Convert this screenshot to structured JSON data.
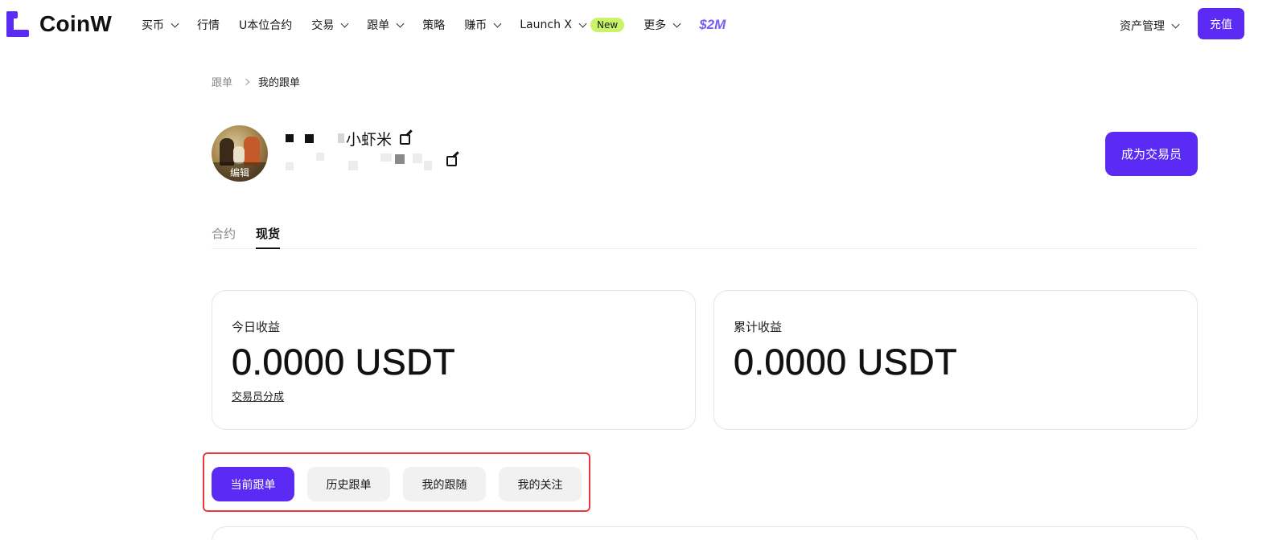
{
  "brand": {
    "name": "CoinW",
    "color": "#5b2bf5"
  },
  "nav": {
    "items": [
      {
        "label": "买币",
        "dropdown": true
      },
      {
        "label": "行情",
        "dropdown": false
      },
      {
        "label": "U本位合约",
        "dropdown": false
      },
      {
        "label": "交易",
        "dropdown": true
      },
      {
        "label": "跟单",
        "dropdown": true
      },
      {
        "label": "策略",
        "dropdown": false
      },
      {
        "label": "赚币",
        "dropdown": true
      },
      {
        "label": "Launch X",
        "dropdown": true,
        "badge": "New"
      },
      {
        "label": "更多",
        "dropdown": true
      }
    ],
    "promo": "$2M",
    "asset_menu": "资产管理",
    "deposit": "充值"
  },
  "breadcrumb": {
    "parent": "跟单",
    "current": "我的跟单"
  },
  "profile": {
    "avatar_edit": "编辑",
    "nickname": "小虾米",
    "become_trader": "成为交易员"
  },
  "tabs": [
    {
      "label": "合约",
      "active": false
    },
    {
      "label": "现货",
      "active": true
    }
  ],
  "cards": {
    "today": {
      "label": "今日收益",
      "value": "0.0000 USDT",
      "link": "交易员分成"
    },
    "total": {
      "label": "累计收益",
      "value": "0.0000 USDT"
    }
  },
  "segments": [
    {
      "label": "当前跟单",
      "active": true
    },
    {
      "label": "历史跟单",
      "active": false
    },
    {
      "label": "我的跟随",
      "active": false
    },
    {
      "label": "我的关注",
      "active": false
    }
  ],
  "colors": {
    "accent": "#5b2bf5",
    "badge": "#c9f46a",
    "highlight": "#e83a3a"
  }
}
